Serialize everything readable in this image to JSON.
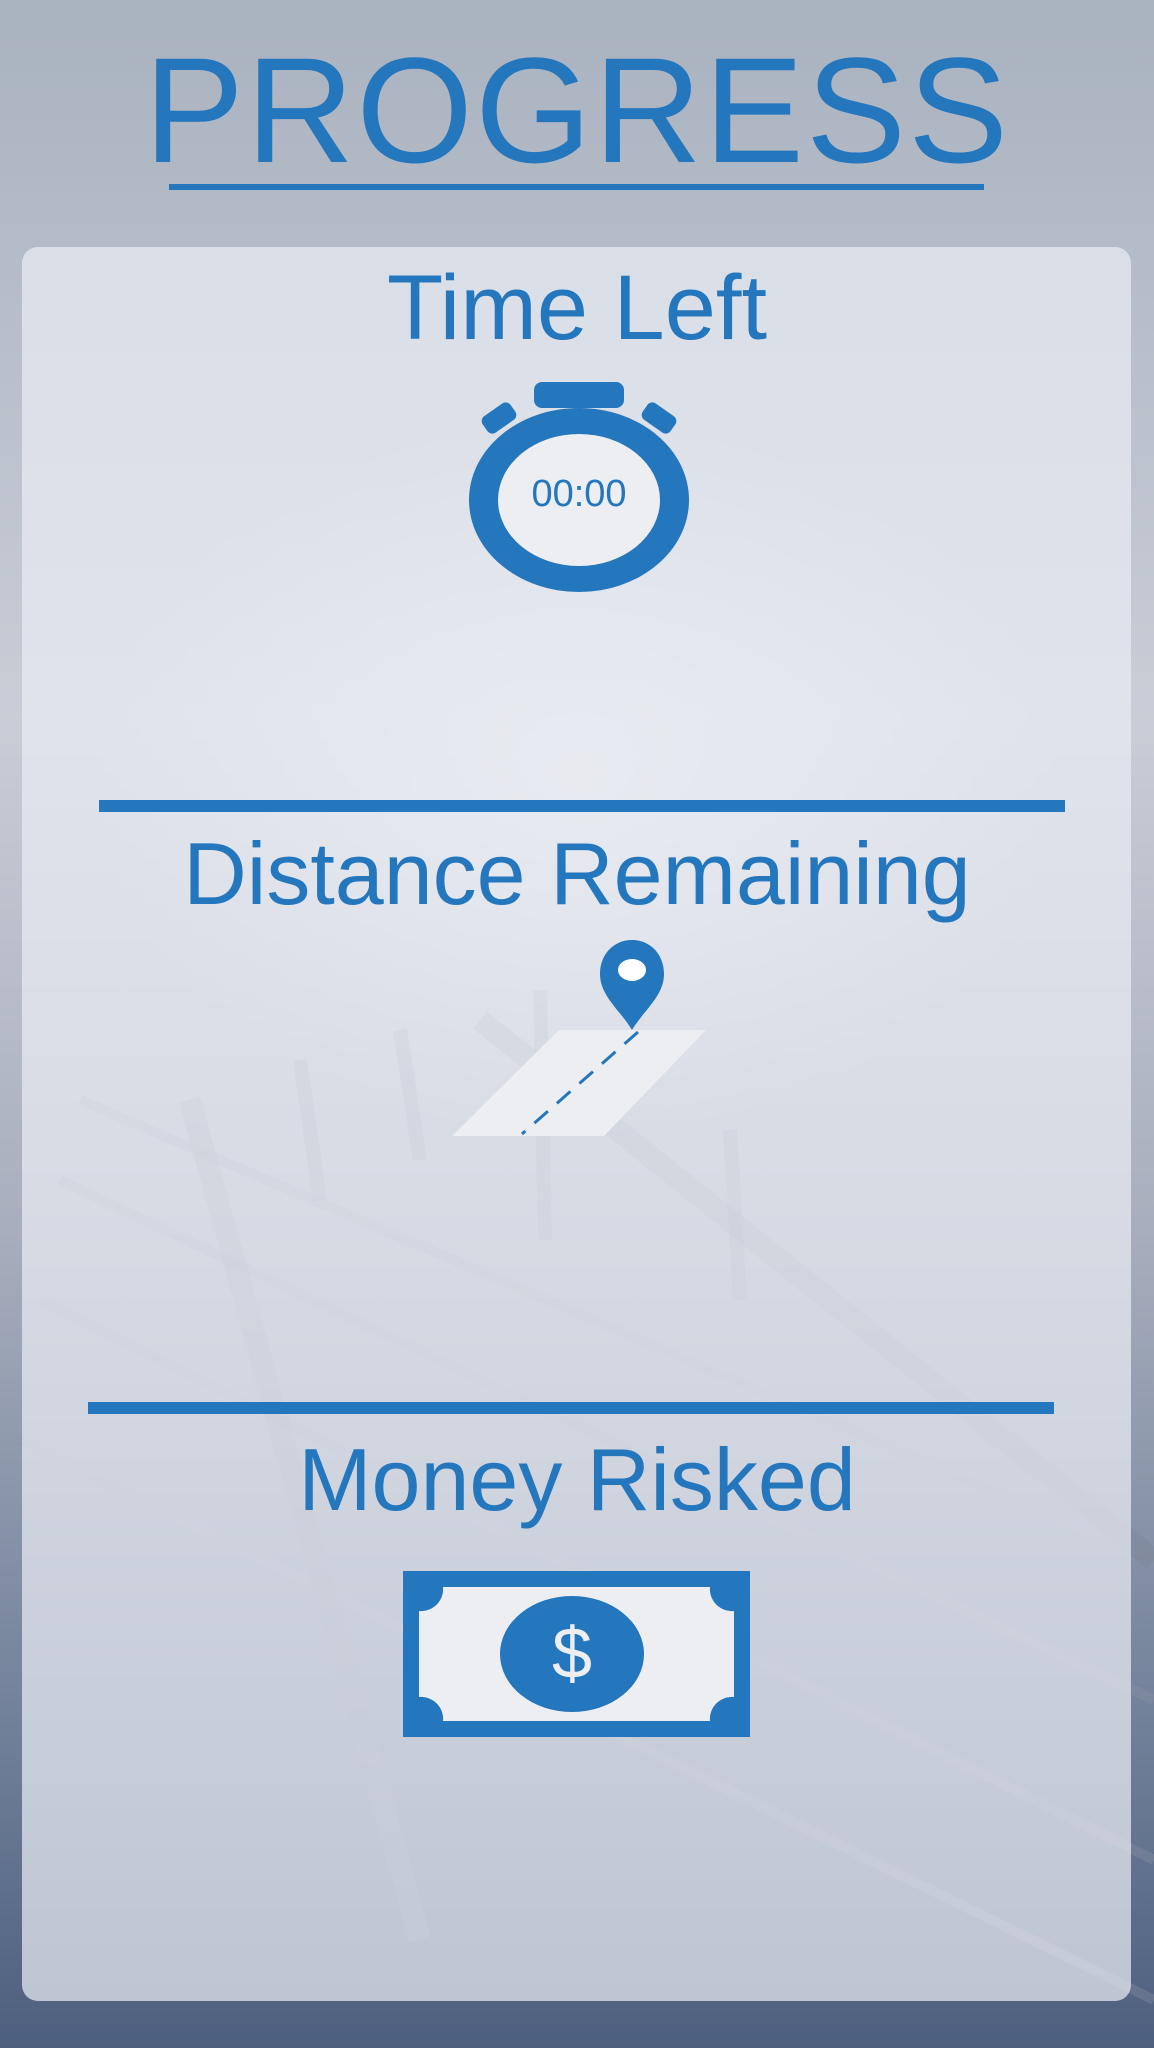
{
  "page": {
    "title": "PROGRESS"
  },
  "sections": {
    "time_left": {
      "heading": "Time Left",
      "timer_value": "00:00",
      "icon": "stopwatch-icon"
    },
    "distance_remaining": {
      "heading": "Distance Remaining",
      "icon": "map-pin-road-icon"
    },
    "money_risked": {
      "heading": "Money Risked",
      "currency_symbol": "$",
      "icon": "dollar-bill-icon"
    }
  },
  "colors": {
    "accent": "#2476bd",
    "card": "#e9ebf2",
    "icon_fill": "#eceef2"
  }
}
